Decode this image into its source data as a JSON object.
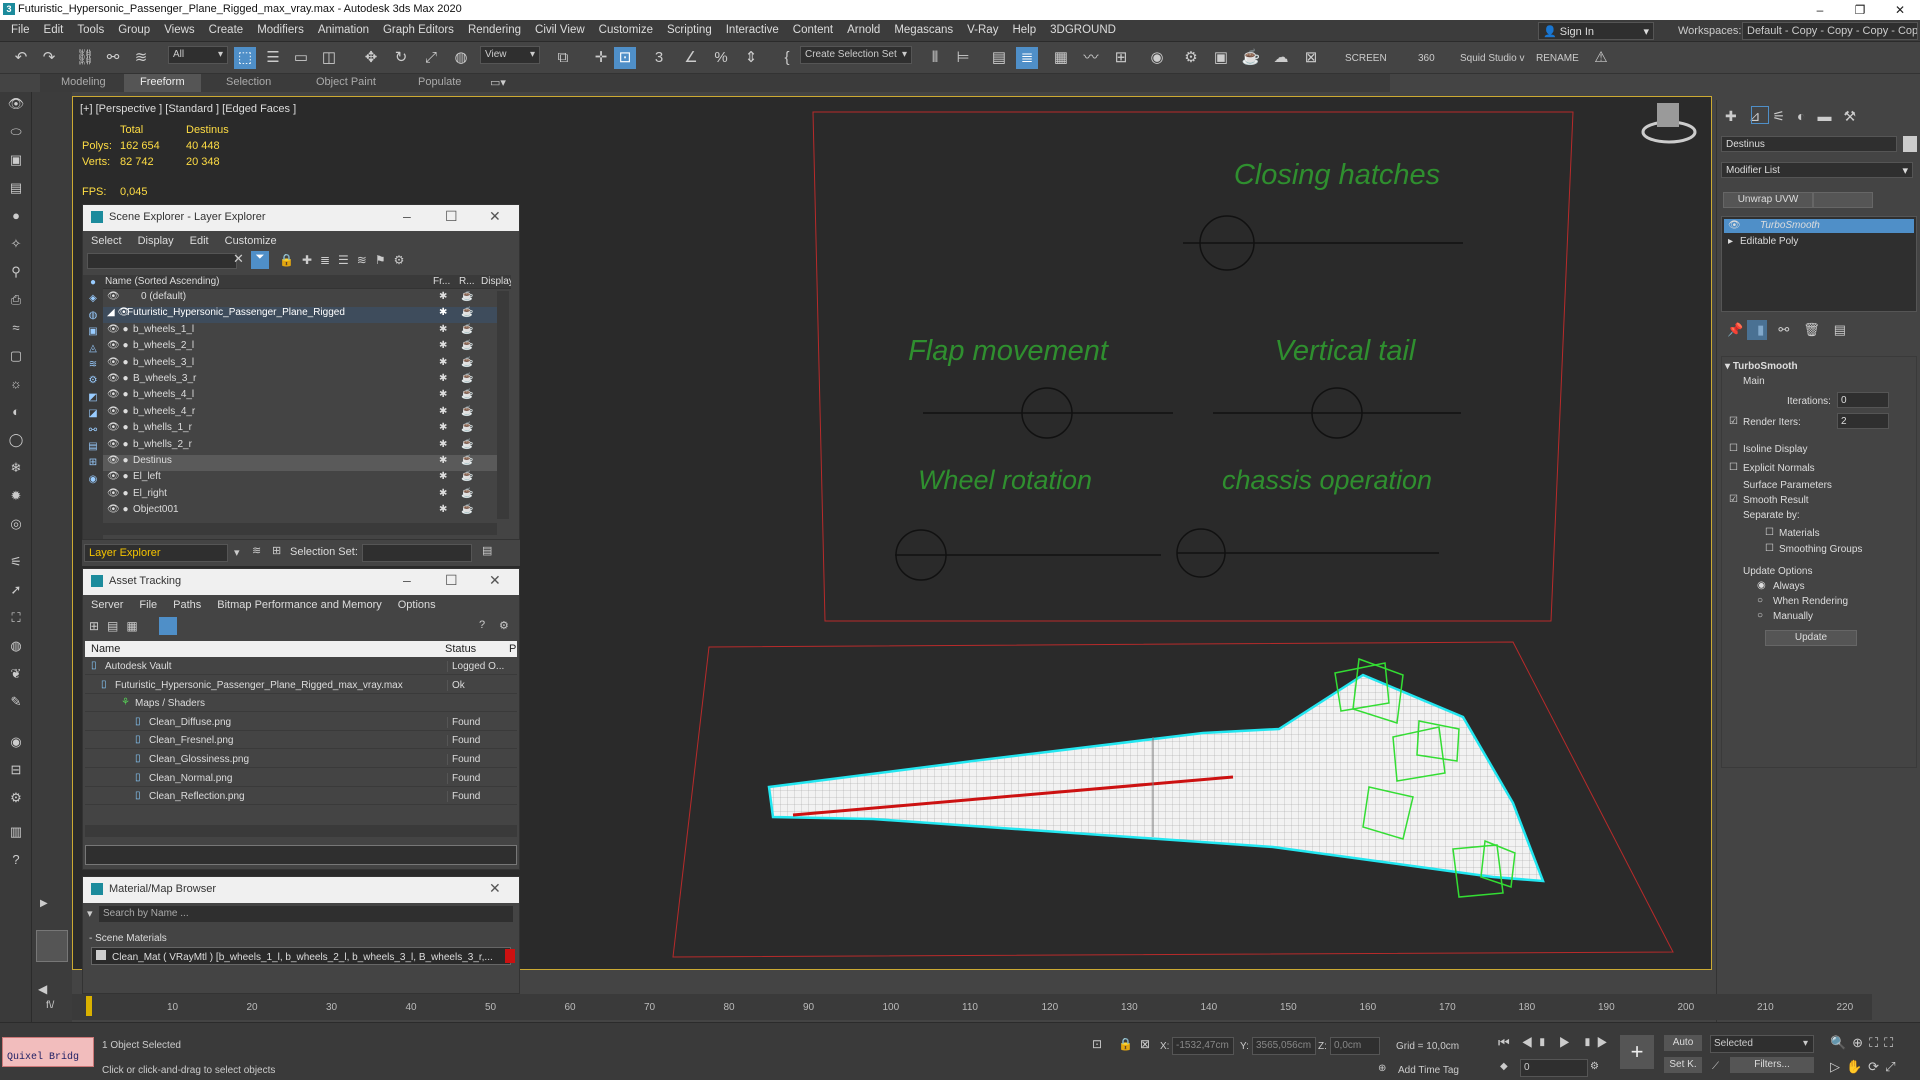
{
  "window": {
    "title": "Futuristic_Hypersonic_Passenger_Plane_Rigged_max_vray.max - Autodesk 3ds Max 2020"
  },
  "menu": [
    "File",
    "Edit",
    "Tools",
    "Group",
    "Views",
    "Create",
    "Modifiers",
    "Animation",
    "Graph Editors",
    "Rendering",
    "Civil View",
    "Customize",
    "Scripting",
    "Interactive",
    "Content",
    "Arnold",
    "Megascans",
    "V-Ray",
    "Help",
    "3DGROUND"
  ],
  "signin": "Sign In",
  "workspaces": {
    "label": "Workspaces:",
    "value": "Default - Copy - Copy - Copy - Copy"
  },
  "toolbar": {
    "selection_filter": "All",
    "view_dropdown": "View",
    "create_selection_set": "Create Selection Set",
    "screen": "SCREEN",
    "value_360": "360",
    "squid": "Squid Studio v",
    "rename": "RENAME"
  },
  "ribbon_tabs": [
    "Modeling",
    "Freeform",
    "Selection",
    "Object Paint",
    "Populate"
  ],
  "viewport": {
    "label": "[+] [Perspective ] [Standard ] [Edged Faces ]",
    "stats": {
      "total_label": "Total",
      "destinus_label": "Destinus",
      "polys_label": "Polys:",
      "polys_total": "162 654",
      "polys_destinus": "40 448",
      "verts_label": "Verts:",
      "verts_total": "82 742",
      "verts_destinus": "20 348",
      "fps_label": "FPS:",
      "fps_value": "0,045"
    },
    "controls": [
      "Closing hatches",
      "Flap movement",
      "Vertical tail",
      "Wheel rotation",
      "chassis operation"
    ]
  },
  "scene_explorer": {
    "title": "Scene Explorer - Layer Explorer",
    "menu": [
      "Select",
      "Display",
      "Edit",
      "Customize"
    ],
    "columns": [
      "Name (Sorted Ascending)",
      "Fr...",
      "R...",
      "Display as B"
    ],
    "rows": [
      "0 (default)",
      "Futuristic_Hypersonic_Passenger_Plane_Rigged",
      "b_wheels_1_l",
      "b_wheels_2_l",
      "b_wheels_3_l",
      "B_wheels_3_r",
      "b_wheels_4_l",
      "b_wheels_4_r",
      "b_whells_1_r",
      "b_whells_2_r",
      "Destinus",
      "El_left",
      "El_right",
      "Object001"
    ],
    "footer_label": "Layer Explorer",
    "selection_set": "Selection Set:"
  },
  "asset_tracking": {
    "title": "Asset Tracking",
    "menu": [
      "Server",
      "File",
      "Paths",
      "Bitmap Performance and Memory",
      "Options"
    ],
    "columns": [
      "Name",
      "Status",
      "P"
    ],
    "rows": [
      {
        "name": "Autodesk Vault",
        "status": "Logged O..."
      },
      {
        "name": "Futuristic_Hypersonic_Passenger_Plane_Rigged_max_vray.max",
        "status": "Ok"
      },
      {
        "name": "Maps / Shaders",
        "status": ""
      },
      {
        "name": "Clean_Diffuse.png",
        "status": "Found"
      },
      {
        "name": "Clean_Fresnel.png",
        "status": "Found"
      },
      {
        "name": "Clean_Glossiness.png",
        "status": "Found"
      },
      {
        "name": "Clean_Normal.png",
        "status": "Found"
      },
      {
        "name": "Clean_Reflection.png",
        "status": "Found"
      }
    ]
  },
  "material_browser": {
    "title": "Material/Map Browser",
    "search_placeholder": "Search by Name ...",
    "section": "- Scene Materials",
    "item": "Clean_Mat  ( VRayMtl )  [b_wheels_1_l, b_wheels_2_l, b_wheels_3_l, B_wheels_3_r,..."
  },
  "command_panel": {
    "object_name": "Destinus",
    "modifier_list": "Modifier List",
    "unwrap": "Unwrap UVW",
    "stack": [
      "TurboSmooth",
      "Editable Poly"
    ],
    "rollout": "TurboSmooth",
    "main": "Main",
    "iterations_label": "Iterations:",
    "iterations_value": "0",
    "render_iters_label": "Render Iters:",
    "render_iters_value": "2",
    "isoline": "Isoline Display",
    "explicit": "Explicit Normals",
    "surface": "Surface Parameters",
    "smooth_result": "Smooth Result",
    "separate_by": "Separate by:",
    "materials": "Materials",
    "smoothing_groups": "Smoothing Groups",
    "update_options": "Update Options",
    "always": "Always",
    "when_rendering": "When Rendering",
    "manually": "Manually",
    "update": "Update"
  },
  "timeline": {
    "ticks": [
      "10",
      "20",
      "30",
      "40",
      "50",
      "60",
      "70",
      "80",
      "90",
      "100",
      "110",
      "120",
      "130",
      "140",
      "150",
      "160",
      "170",
      "180",
      "190",
      "200",
      "210",
      "220"
    ]
  },
  "status": {
    "quixel": "Quixel Bridg",
    "selected": "1 Object Selected",
    "hint": "Click or click-and-drag to select objects",
    "x_label": "X:",
    "x_value": "-1532,47cm",
    "y_label": "Y:",
    "y_value": "3565,056cm",
    "z_label": "Z:",
    "z_value": "0,0cm",
    "grid": "Grid = 10,0cm",
    "add_time_tag": "Add Time Tag",
    "auto": "Auto",
    "selected_dd": "Selected",
    "set_k": "Set K.",
    "filters": "Filters...",
    "frame": "0"
  },
  "colors": {
    "accent": "#4f8fc8",
    "control_text": "#2f8f2f",
    "viewport_bg": "#2a2a2a",
    "cyan_outline": "#22e6f0",
    "rig_green": "#33dd33",
    "red_frame": "#b82a2a"
  }
}
